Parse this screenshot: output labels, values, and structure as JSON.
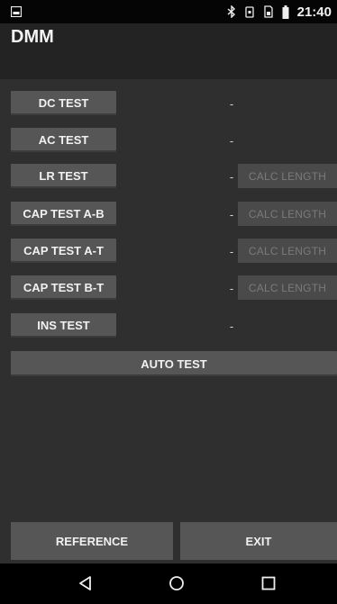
{
  "status_bar": {
    "time": "21:40",
    "icons": [
      "notification-icon",
      "bluetooth-icon",
      "vibrate-icon",
      "sim-icon",
      "battery-icon"
    ]
  },
  "app": {
    "title": "DMM"
  },
  "tests": [
    {
      "label": "DC TEST",
      "value": "-"
    },
    {
      "label": "AC TEST",
      "value": "-"
    },
    {
      "label": "LR TEST",
      "value": "-",
      "calc_label": "CALC LENGTH"
    },
    {
      "label": "CAP TEST A-B",
      "value": "-",
      "calc_label": "CALC LENGTH"
    },
    {
      "label": "CAP TEST A-T",
      "value": "-",
      "calc_label": "CALC LENGTH"
    },
    {
      "label": "CAP TEST B-T",
      "value": "-",
      "calc_label": "CALC LENGTH"
    },
    {
      "label": "INS TEST",
      "value": "-"
    }
  ],
  "auto_test": {
    "label": "AUTO TEST"
  },
  "bottom": {
    "reference_label": "REFERENCE",
    "exit_label": "EXIT"
  },
  "nav": {
    "icons": [
      "back-icon",
      "home-icon",
      "recents-icon"
    ]
  },
  "colors": {
    "background": "#2f2f2f",
    "app_bar": "#232323",
    "button": "#565656",
    "button_disabled": "#4a4a4a",
    "text": "#f1f1f1",
    "text_disabled": "#7a7a7a"
  }
}
